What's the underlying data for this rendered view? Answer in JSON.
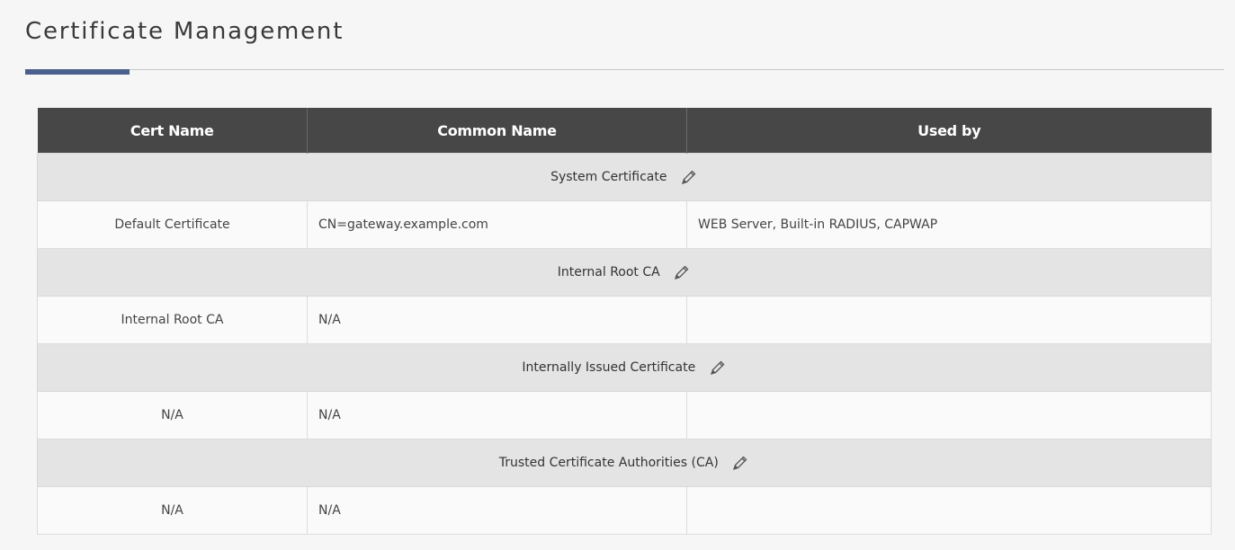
{
  "page": {
    "title": "Certificate Management"
  },
  "table": {
    "headers": {
      "cert_name": "Cert Name",
      "common_name": "Common Name",
      "used_by": "Used by"
    },
    "sections": [
      {
        "title": "System Certificate",
        "row": {
          "cert_name": "Default Certificate",
          "common_name": "CN=gateway.example.com",
          "used_by": "WEB Server, Built-in RADIUS, CAPWAP"
        }
      },
      {
        "title": "Internal Root CA",
        "row": {
          "cert_name": "Internal Root CA",
          "common_name": "N/A",
          "used_by": ""
        }
      },
      {
        "title": "Internally Issued Certificate",
        "row": {
          "cert_name": "N/A",
          "common_name": "N/A",
          "used_by": ""
        }
      },
      {
        "title": "Trusted Certificate Authorities (CA)",
        "row": {
          "cert_name": "N/A",
          "common_name": "N/A",
          "used_by": ""
        }
      }
    ]
  },
  "icons": {
    "edit": "pencil-icon"
  },
  "colors": {
    "header_bg": "#474747",
    "section_bg": "#e4e4e4",
    "accent": "#4a5f8c"
  }
}
